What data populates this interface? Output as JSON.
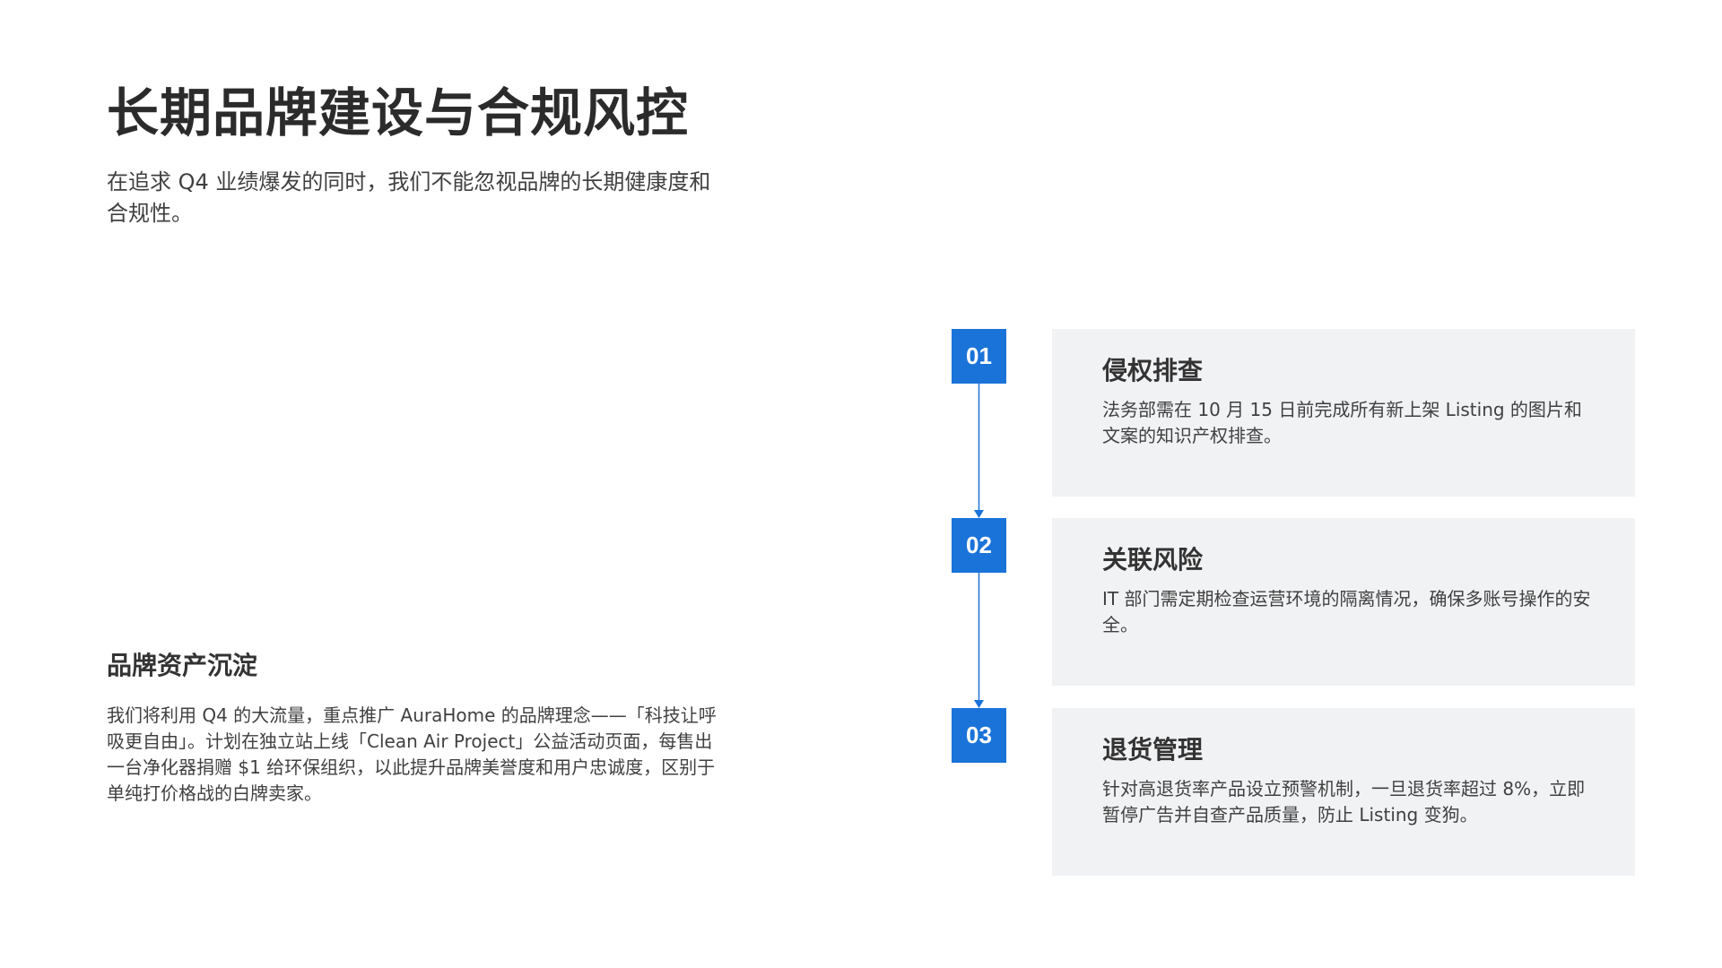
{
  "header": {
    "title": "长期品牌建设与合规风控",
    "subtitle": "在追求 Q4 业绩爆发的同时，我们不能忽视品牌的长期健康度和合规性。"
  },
  "brand_section": {
    "heading": "品牌资产沉淀",
    "body": "我们将利用 Q4 的大流量，重点推广 AuraHome 的品牌理念——「科技让呼吸更自由」。计划在独立站上线「Clean Air Project」公益活动页面，每售出一台净化器捐赠 $1 给环保组织，以此提升品牌美誉度和用户忠诚度，区别于单纯打价格战的白牌卖家。"
  },
  "steps": [
    {
      "number": "01",
      "title": "侵权排查",
      "desc": "法务部需在 10 月 15 日前完成所有新上架 Listing 的图片和文案的知识产权排查。"
    },
    {
      "number": "02",
      "title": "关联风险",
      "desc": "IT 部门需定期检查运营环境的隔离情况，确保多账号操作的安全。"
    },
    {
      "number": "03",
      "title": "退货管理",
      "desc": "针对高退货率产品设立预警机制，一旦退货率超过 8%，立即暂停广告并自查产品质量，防止 Listing 变狗。"
    }
  ],
  "colors": {
    "accent": "#1a73d9",
    "card_bg": "#f1f2f4",
    "text": "#333333"
  }
}
